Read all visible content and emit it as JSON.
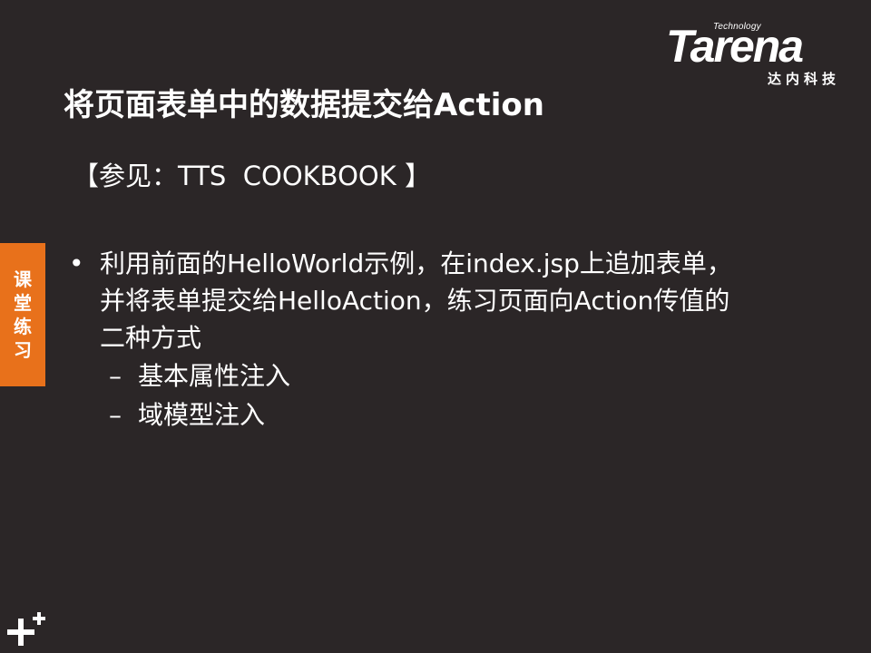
{
  "logo": {
    "tech": "Technology",
    "word": "Tarena",
    "cn": "达内科技"
  },
  "slide": {
    "title": "将页面表单中的数据提交给Action",
    "reference": "【参见：TTS  COOKBOOK 】",
    "side_tab": [
      "课",
      "堂",
      "练",
      "习"
    ],
    "bullet": {
      "lines": [
        "利用前面的HelloWorld示例，在index.jsp上追加表单，",
        "并将表单提交给HelloAction，练习页面向Action传值的",
        "二种方式"
      ],
      "sub_items": [
        "基本属性注入",
        "域模型注入"
      ]
    }
  },
  "glyphs": {
    "bullet": "•",
    "dash": "–"
  },
  "icons": {
    "corner": "plus-icon"
  },
  "colors": {
    "background": "#2b2627",
    "accent": "#e8711b",
    "text": "#ffffff"
  }
}
